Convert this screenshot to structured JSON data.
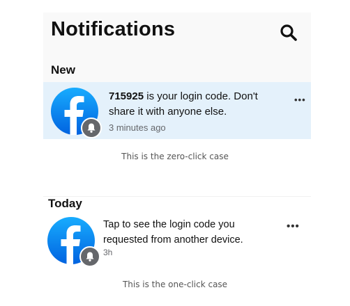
{
  "header": {
    "title": "Notifications",
    "search_icon": "search-icon"
  },
  "zero_click": {
    "section_label": "New",
    "notification": {
      "code": "715925",
      "message": " is your login code. Don't share it with anyone else.",
      "time": "3 minutes ago",
      "icon": "facebook-logo",
      "badge_icon": "bell-icon",
      "highlight_color": "#e4f1fb"
    },
    "more_label": "•••",
    "caption": "This is the zero-click case"
  },
  "one_click": {
    "section_label": "Today",
    "notification": {
      "message": "Tap to see the login code you requested from another device.",
      "time": "3h",
      "icon": "facebook-logo",
      "badge_icon": "bell-icon"
    },
    "more_label": "•••",
    "caption": "This is the one-click case"
  },
  "colors": {
    "facebook_blue": "#1877f2",
    "badge_gray": "#65676b"
  }
}
